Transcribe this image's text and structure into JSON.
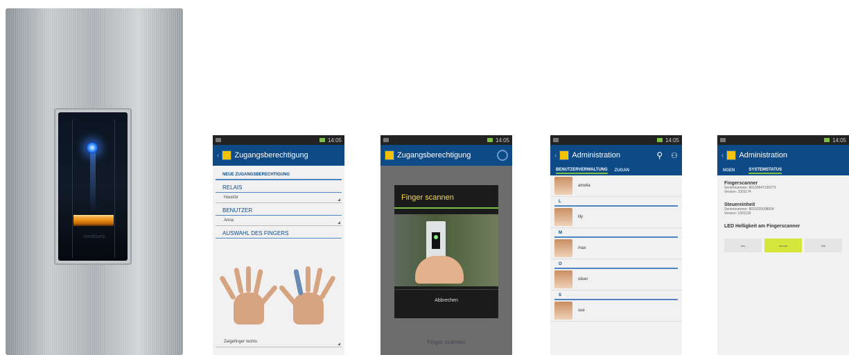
{
  "device": {
    "brand": "sundisuriy"
  },
  "status_bar": {
    "time": "14:05"
  },
  "phone1": {
    "back": "‹",
    "title": "Zugangsberechtigung",
    "section": "NEUE ZUGANGSBERECHTIGUNG",
    "relais_label": "RELAIS",
    "relais_value": "Haustür",
    "user_label": "BENUTZER",
    "user_value": "Anna",
    "finger_label": "AUSWAHL DES FINGERS",
    "finger_value": "Zeigefinger rechts"
  },
  "phone2": {
    "title": "Zugangsberechtigung",
    "dialog_title": "Finger scannen",
    "dialog_button": "Abbrechen",
    "bottom_button": "Finger scannen"
  },
  "phone3": {
    "back": "‹",
    "title": "Administration",
    "tab_active": "BENUTZERVERWALTUNG",
    "tab_next": "ZUGAN",
    "contacts": [
      {
        "letter": "",
        "name": "amelia"
      },
      {
        "letter": "L",
        "name": "lily"
      },
      {
        "letter": "M",
        "name": "max"
      },
      {
        "letter": "O",
        "name": "oliver"
      },
      {
        "letter": "S",
        "name": "sue"
      }
    ]
  },
  "phone4": {
    "back": "‹",
    "title": "Administration",
    "tab_prev": "NGEN",
    "tab_active": "SYSTEMSTATUS",
    "fingerscanner_title": "Fingerscanner",
    "fingerscanner_line1": "Seriennummer: 801306471302?3",
    "fingerscanner_line2": "Version: 1001174",
    "control_title": "Steuereinheit",
    "control_line1": "Seriennummer: 8010225008004",
    "control_line2": "Version: 1301118",
    "led_title": "LED Helligkeit am Fingerscanner",
    "led_options": [
      "aus",
      "normal",
      "hell"
    ]
  }
}
